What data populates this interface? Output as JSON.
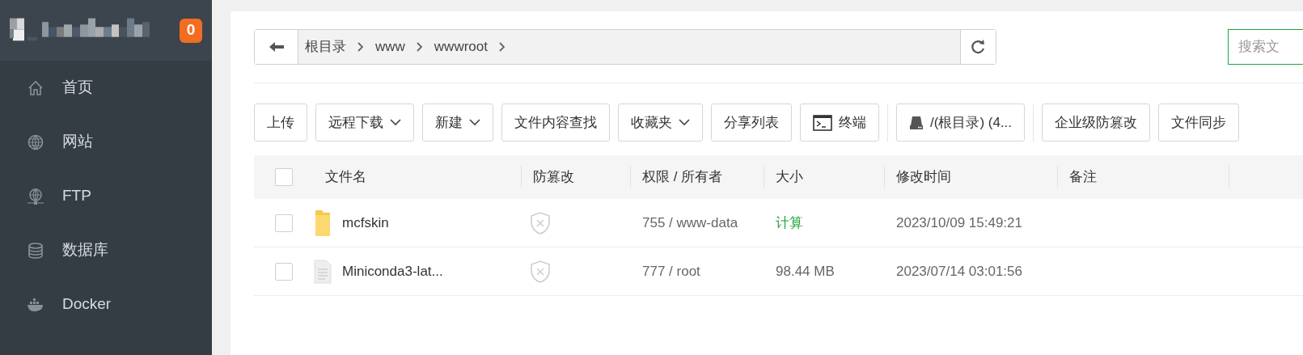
{
  "sidebar": {
    "badge": "0",
    "items": [
      {
        "label": "首页",
        "selected": false
      },
      {
        "label": "网站",
        "selected": false
      },
      {
        "label": "FTP",
        "selected": false
      },
      {
        "label": "数据库",
        "selected": false
      },
      {
        "label": "Docker",
        "selected": false
      }
    ]
  },
  "breadcrumb": [
    "根目录",
    "www",
    "wwwroot"
  ],
  "search": {
    "placeholder": "搜索文"
  },
  "toolbar": [
    {
      "label": "上传",
      "kind": "plain"
    },
    {
      "label": "远程下载",
      "kind": "dropdown"
    },
    {
      "label": "新建",
      "kind": "dropdown"
    },
    {
      "label": "文件内容查找",
      "kind": "plain"
    },
    {
      "label": "收藏夹",
      "kind": "dropdown"
    },
    {
      "label": "分享列表",
      "kind": "plain"
    },
    {
      "label": "终端",
      "kind": "terminal"
    },
    {
      "kind": "divider"
    },
    {
      "label": "/(根目录) (4...",
      "kind": "disk"
    },
    {
      "kind": "divider"
    },
    {
      "label": "企业级防篡改",
      "kind": "plain"
    },
    {
      "label": "文件同步",
      "kind": "plain"
    }
  ],
  "table": {
    "all_checked": false,
    "columns": [
      "文件名",
      "防篡改",
      "权限 / 所有者",
      "大小",
      "修改时间",
      "备注"
    ],
    "rows": [
      {
        "checked": false,
        "kind": "folder",
        "name": "mcfskin",
        "permission": "755 / www-data",
        "size": "计算",
        "modified": "2023/10/09 15:49:21"
      },
      {
        "checked": false,
        "kind": "file",
        "name": "Miniconda3-lat...",
        "permission": "777 / root",
        "size": "98.44 MB",
        "modified": "2023/07/14 03:01:56"
      }
    ]
  }
}
